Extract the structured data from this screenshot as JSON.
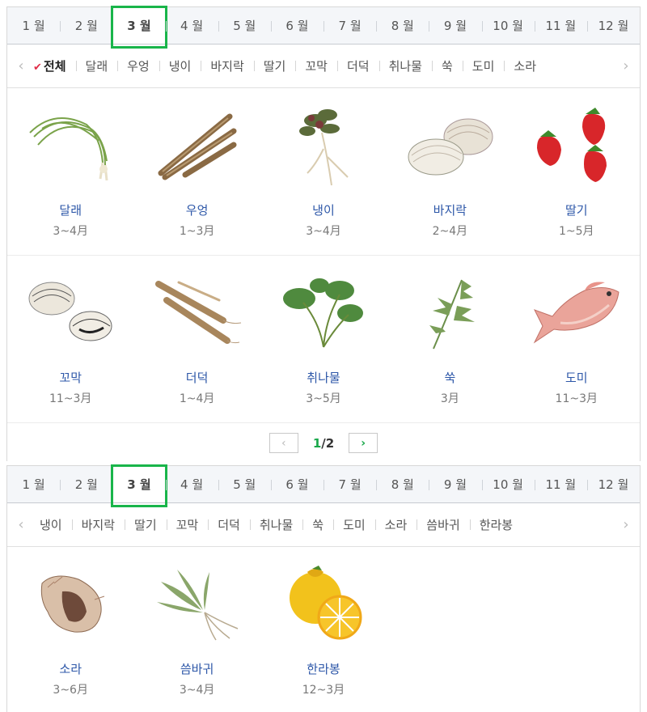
{
  "months": [
    "1 월",
    "2 월",
    "3 월",
    "4 월",
    "5 월",
    "6 월",
    "7 월",
    "8 월",
    "9 월",
    "10 월",
    "11 월",
    "12 월"
  ],
  "top": {
    "categories": [
      "전체",
      "달래",
      "우엉",
      "냉이",
      "바지락",
      "딸기",
      "꼬막",
      "더덕",
      "취나물",
      "쑥",
      "도미",
      "소라"
    ],
    "row1": [
      {
        "name": "달래",
        "period": "3~4月",
        "icon": "dallae-illustration"
      },
      {
        "name": "우엉",
        "period": "1~3月",
        "icon": "burdock-illustration"
      },
      {
        "name": "냉이",
        "period": "3~4月",
        "icon": "shepherds-purse-illustration"
      },
      {
        "name": "바지락",
        "period": "2~4月",
        "icon": "clam-illustration"
      },
      {
        "name": "딸기",
        "period": "1~5月",
        "icon": "strawberry-illustration"
      }
    ],
    "row2": [
      {
        "name": "꼬막",
        "period": "11~3月",
        "icon": "cockle-illustration"
      },
      {
        "name": "더덕",
        "period": "1~4月",
        "icon": "deodeok-illustration"
      },
      {
        "name": "취나물",
        "period": "3~5月",
        "icon": "chwinamul-illustration"
      },
      {
        "name": "쑥",
        "period": "3月",
        "icon": "mugwort-illustration"
      },
      {
        "name": "도미",
        "period": "11~3月",
        "icon": "sea-bream-illustration"
      }
    ],
    "pager": {
      "current": "1",
      "total": "/2"
    }
  },
  "bottom": {
    "categories": [
      "냉이",
      "바지락",
      "딸기",
      "꼬막",
      "더덕",
      "취나물",
      "쑥",
      "도미",
      "소라",
      "씀바귀",
      "한라봉"
    ],
    "row1": [
      {
        "name": "소라",
        "period": "3~6月",
        "icon": "conch-illustration"
      },
      {
        "name": "씀바귀",
        "period": "3~4月",
        "icon": "sseumbagwi-illustration"
      },
      {
        "name": "한라봉",
        "period": "12~3月",
        "icon": "hallabong-illustration"
      }
    ]
  },
  "colors": {
    "active_border": "#19b54a",
    "name_link": "#2d57a8",
    "check": "#e02f4a"
  }
}
